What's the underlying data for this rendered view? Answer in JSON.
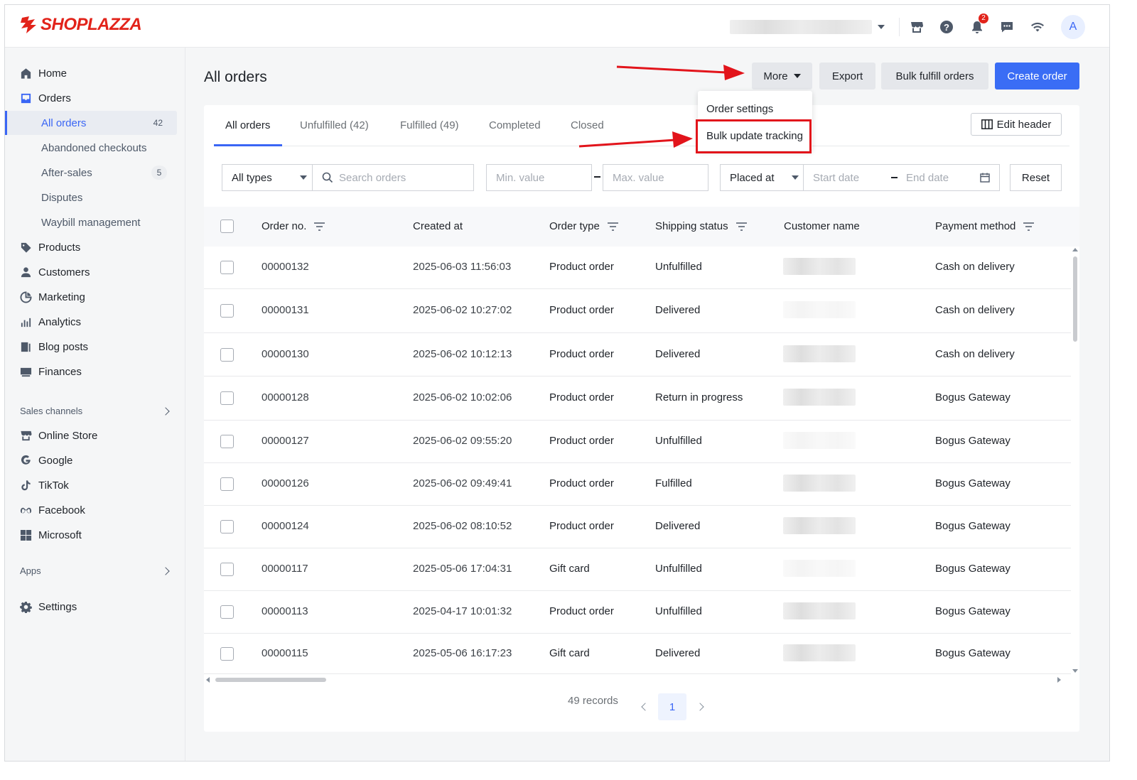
{
  "header": {
    "brand": "SHOPLAZZA",
    "notification_count": "2",
    "avatar_initial": "A",
    "icons": [
      "store-icon",
      "help-icon",
      "bell-icon",
      "chat-icon",
      "wifi-icon"
    ]
  },
  "sidebar": {
    "items": [
      {
        "label": "Home",
        "icon": "home-icon"
      },
      {
        "label": "Orders",
        "icon": "inbox-icon"
      },
      {
        "label": "All orders",
        "count": "42",
        "active": true
      },
      {
        "label": "Abandoned checkouts"
      },
      {
        "label": "After-sales",
        "count": "5"
      },
      {
        "label": "Disputes"
      },
      {
        "label": "Waybill management"
      },
      {
        "label": "Products",
        "icon": "tag-icon"
      },
      {
        "label": "Customers",
        "icon": "person-icon"
      },
      {
        "label": "Marketing",
        "icon": "megaphone-icon"
      },
      {
        "label": "Analytics",
        "icon": "bar-chart-icon"
      },
      {
        "label": "Blog posts",
        "icon": "blog-icon"
      },
      {
        "label": "Finances",
        "icon": "finance-icon"
      }
    ],
    "sales_channels_label": "Sales channels",
    "channels": [
      {
        "label": "Online Store",
        "icon": "store-icon"
      },
      {
        "label": "Google",
        "icon": "google-icon"
      },
      {
        "label": "TikTok",
        "icon": "tiktok-icon"
      },
      {
        "label": "Facebook",
        "icon": "meta-icon"
      },
      {
        "label": "Microsoft",
        "icon": "microsoft-icon"
      }
    ],
    "apps_label": "Apps",
    "settings_label": "Settings"
  },
  "page": {
    "title": "All orders",
    "buttons": {
      "more": "More",
      "export": "Export",
      "bulk_fulfill": "Bulk fulfill orders",
      "create": "Create order"
    },
    "more_menu": [
      "Order settings",
      "Bulk update tracking"
    ],
    "tabs": [
      "All orders",
      "Unfulfilled (42)",
      "Fulfilled (49)",
      "Completed",
      "Closed"
    ],
    "edit_header": "Edit header"
  },
  "filters": {
    "type": "All types",
    "search_placeholder": "Search orders",
    "min_placeholder": "Min. value",
    "max_placeholder": "Max. value",
    "date_field": "Placed at",
    "start_placeholder": "Start date",
    "end_placeholder": "End date",
    "reset": "Reset"
  },
  "table": {
    "columns": [
      "Order no.",
      "Created at",
      "Order type",
      "Shipping status",
      "Customer name",
      "Payment method"
    ],
    "rows": [
      {
        "order": "00000132",
        "created": "2025-06-03 11:56:03",
        "type": "Product order",
        "status": "Unfulfilled",
        "payment": "Cash on delivery"
      },
      {
        "order": "00000131",
        "created": "2025-06-02 10:27:02",
        "type": "Product order",
        "status": "Delivered",
        "payment": "Cash on delivery"
      },
      {
        "order": "00000130",
        "created": "2025-06-02 10:12:13",
        "type": "Product order",
        "status": "Delivered",
        "payment": "Cash on delivery"
      },
      {
        "order": "00000128",
        "created": "2025-06-02 10:02:06",
        "type": "Product order",
        "status": "Return in progress",
        "payment": "Bogus Gateway"
      },
      {
        "order": "00000127",
        "created": "2025-06-02 09:55:20",
        "type": "Product order",
        "status": "Unfulfilled",
        "payment": "Bogus Gateway"
      },
      {
        "order": "00000126",
        "created": "2025-06-02 09:49:41",
        "type": "Product order",
        "status": "Fulfilled",
        "payment": "Bogus Gateway"
      },
      {
        "order": "00000124",
        "created": "2025-06-02 08:10:52",
        "type": "Product order",
        "status": "Delivered",
        "payment": "Bogus Gateway"
      },
      {
        "order": "00000117",
        "created": "2025-05-06 17:04:31",
        "type": "Gift card",
        "status": "Unfulfilled",
        "payment": "Bogus Gateway"
      },
      {
        "order": "00000113",
        "created": "2025-04-17 10:01:32",
        "type": "Product order",
        "status": "Unfulfilled",
        "payment": "Bogus Gateway"
      },
      {
        "order": "00000115",
        "created": "2025-05-06 16:17:23",
        "type": "Gift card",
        "status": "Delivered",
        "payment": "Bogus Gateway"
      }
    ]
  },
  "pagination": {
    "records": "49 records",
    "current": "1"
  },
  "colors": {
    "accent": "#3a66f5",
    "primary_button": "#3a6df5",
    "brand": "#e2231a",
    "annotation": "#e2141b"
  }
}
